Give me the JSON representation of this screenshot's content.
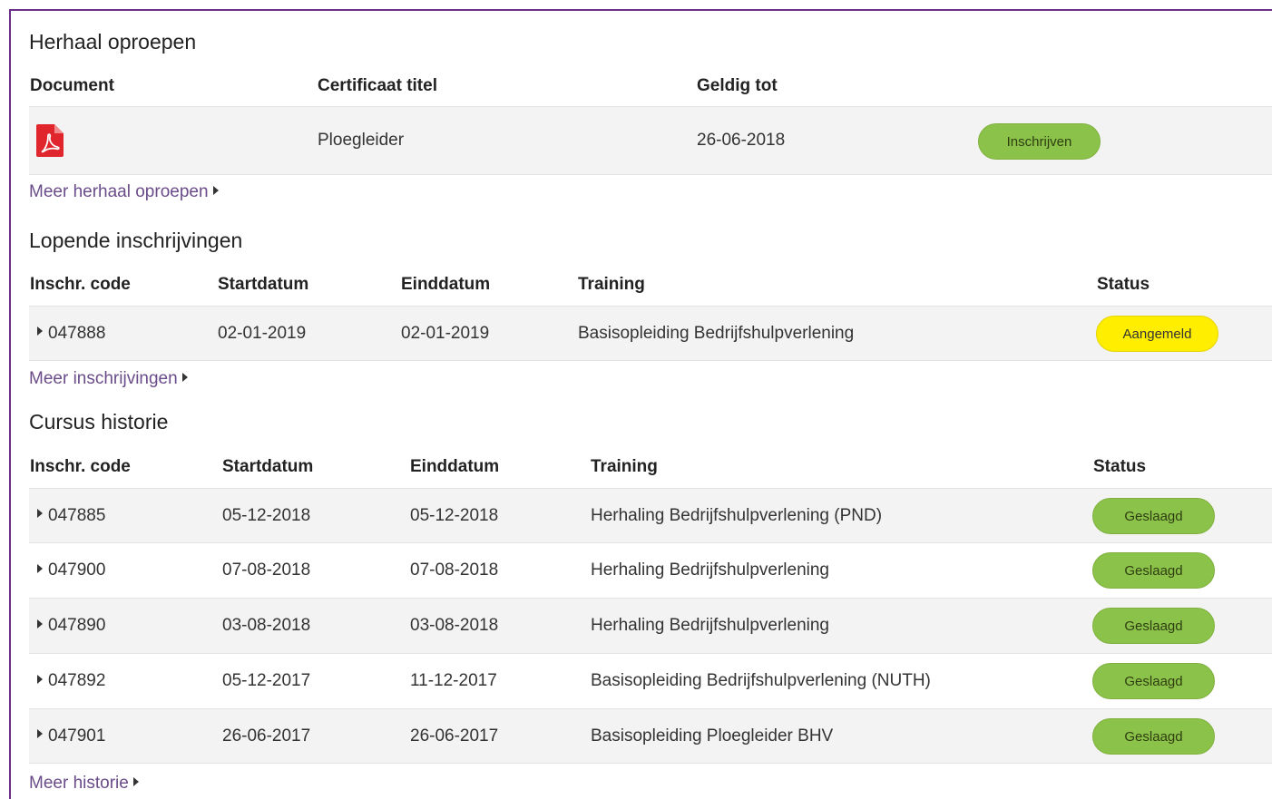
{
  "herhaal": {
    "title": "Herhaal oproepen",
    "headers": {
      "document": "Document",
      "certificaat": "Certificaat titel",
      "geldig": "Geldig tot"
    },
    "row": {
      "document_icon": "pdf-icon",
      "certificaat": "Ploegleider",
      "geldig": "26-06-2018",
      "button": "Inschrijven"
    },
    "more": "Meer herhaal oproepen"
  },
  "lopende": {
    "title": "Lopende inschrijvingen",
    "headers": {
      "code": "Inschr. code",
      "start": "Startdatum",
      "eind": "Einddatum",
      "training": "Training",
      "status": "Status"
    },
    "row": {
      "code": "047888",
      "start": "02-01-2019",
      "eind": "02-01-2019",
      "training": "Basisopleiding Bedrijfshulpverlening",
      "status": "Aangemeld"
    },
    "more": "Meer inschrijvingen"
  },
  "historie": {
    "title": "Cursus historie",
    "headers": {
      "code": "Inschr. code",
      "start": "Startdatum",
      "eind": "Einddatum",
      "training": "Training",
      "status": "Status"
    },
    "rows": [
      {
        "code": "047885",
        "start": "05-12-2018",
        "eind": "05-12-2018",
        "training": "Herhaling Bedrijfshulpverlening (PND)",
        "status": "Geslaagd"
      },
      {
        "code": "047900",
        "start": "07-08-2018",
        "eind": "07-08-2018",
        "training": "Herhaling Bedrijfshulpverlening",
        "status": "Geslaagd"
      },
      {
        "code": "047890",
        "start": "03-08-2018",
        "eind": "03-08-2018",
        "training": "Herhaling Bedrijfshulpverlening",
        "status": "Geslaagd"
      },
      {
        "code": "047892",
        "start": "05-12-2017",
        "eind": "11-12-2017",
        "training": "Basisopleiding Bedrijfshulpverlening (NUTH)",
        "status": "Geslaagd"
      },
      {
        "code": "047901",
        "start": "26-06-2017",
        "eind": "26-06-2017",
        "training": "Basisopleiding Ploegleider BHV",
        "status": "Geslaagd"
      }
    ],
    "more": "Meer historie"
  },
  "colors": {
    "accent": "#6b2f8a",
    "success": "#8bc34a",
    "pending": "#ffee00",
    "pdf": "#e0262c"
  }
}
